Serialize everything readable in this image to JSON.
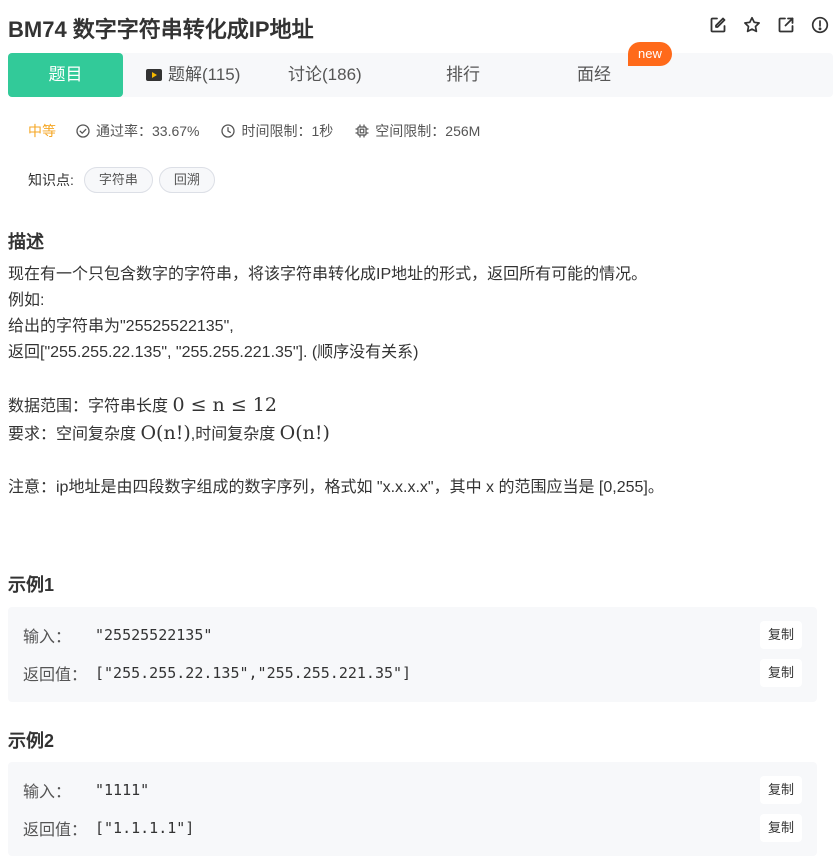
{
  "header": {
    "title": "BM74  数字字符串转化成IP地址",
    "icons": [
      "edit-icon",
      "star-icon",
      "share-icon",
      "info-icon"
    ]
  },
  "tabs": [
    {
      "label": "题目",
      "active": true
    },
    {
      "label": "题解(115)",
      "icon": "video-icon"
    },
    {
      "label": "讨论(186)"
    },
    {
      "label": "排行"
    },
    {
      "label": "面经",
      "badge": "new"
    }
  ],
  "meta": {
    "difficulty": "中等",
    "pass_rate": "通过率：33.67%",
    "time_limit": "时间限制：1秒",
    "memory_limit": "空间限制：256M"
  },
  "knowledge": {
    "label": "知识点:",
    "tags": [
      "字符串",
      "回溯"
    ]
  },
  "description": {
    "title": "描述",
    "line1": "现在有一个只包含数字的字符串，将该字符串转化成IP地址的形式，返回所有可能的情况。",
    "line2": "例如:",
    "line3": "给出的字符串为\"25525522135\",",
    "line4": "返回[\"255.255.22.135\", \"255.255.221.35\"]. (顺序没有关系)",
    "range_prefix": "数据范围：字符串长度",
    "range_math": "0 ≤ n ≤ 12",
    "req_prefix": "要求：空间复杂度",
    "req_math1": "O(n!)",
    "req_middle": ",时间复杂度",
    "req_math2": "O(n!)",
    "note": "注意：ip地址是由四段数字组成的数字序列，格式如 \"x.x.x.x\"，其中 x 的范围应当是 [0,255]。"
  },
  "examples": [
    {
      "title": "示例1",
      "input_label": "输入：",
      "input_value": "\"25525522135\"",
      "output_label": "返回值：",
      "output_value": "[\"255.255.22.135\",\"255.255.221.35\"]",
      "copy_label": "复制"
    },
    {
      "title": "示例2",
      "input_label": "输入：",
      "input_value": "\"1111\"",
      "output_label": "返回值：",
      "output_value": "[\"1.1.1.1\"]",
      "copy_label": "复制"
    }
  ],
  "colors": {
    "accent": "#32ca99",
    "difficulty": "#f5a623",
    "new_badge": "#ff6a1a"
  }
}
